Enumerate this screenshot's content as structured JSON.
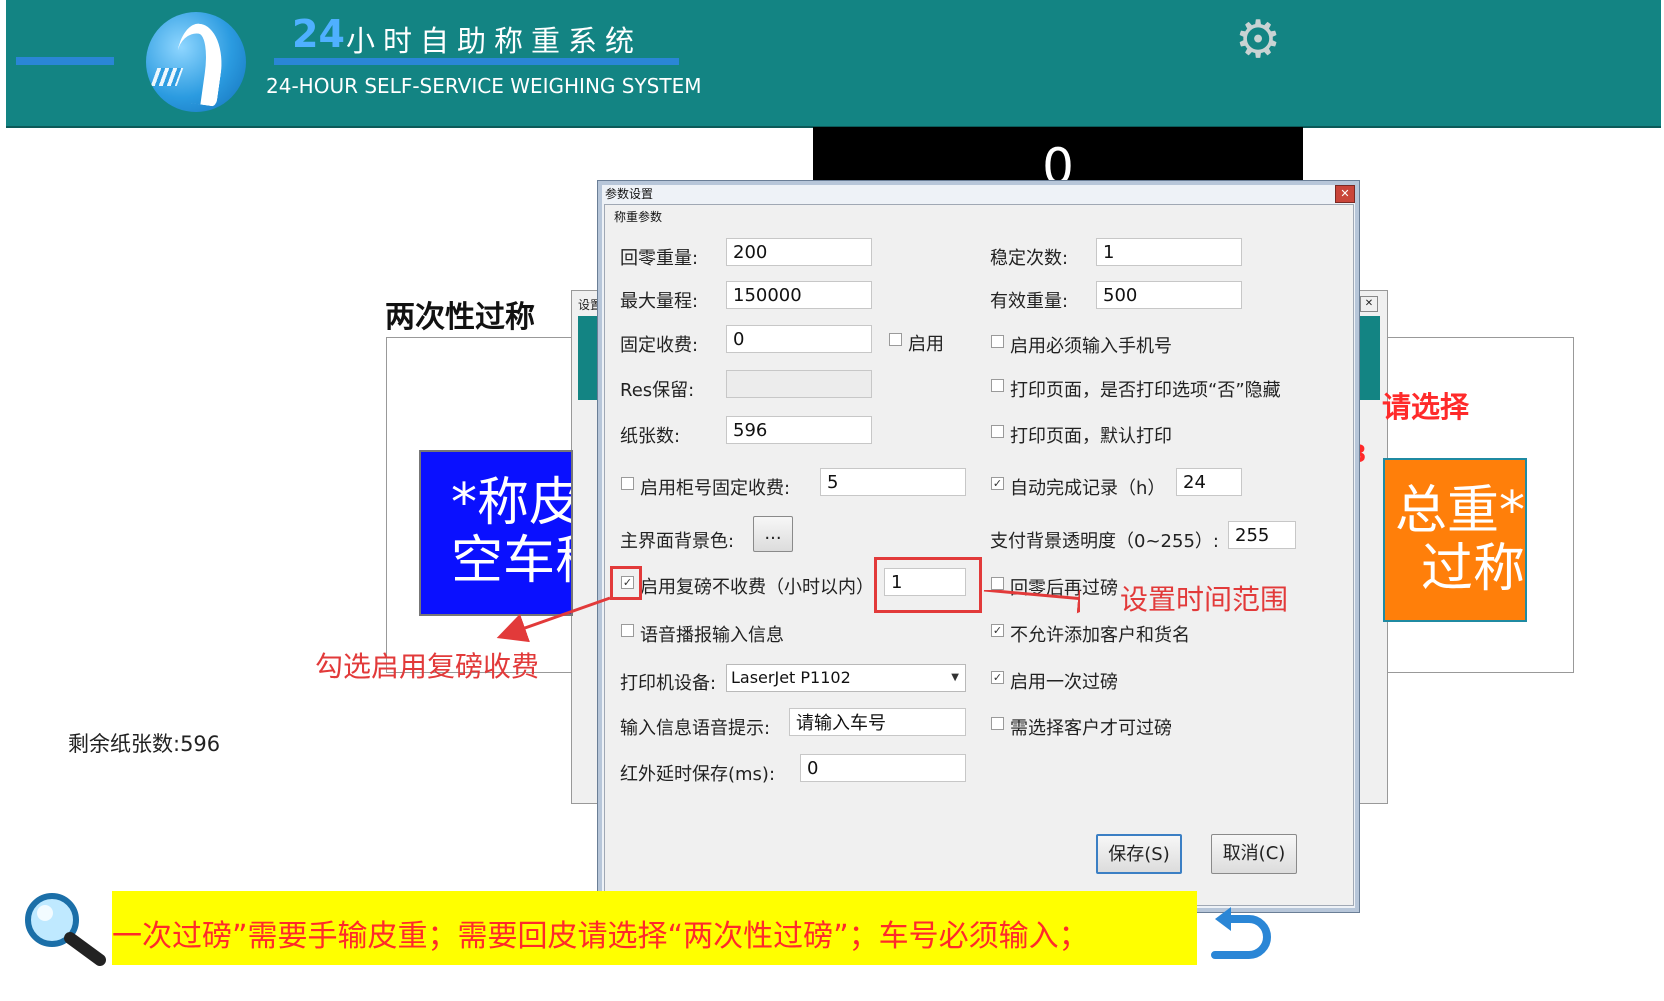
{
  "header": {
    "number": "24",
    "title": "小时自助称重系统",
    "subtitle": "24-HOUR SELF-SERVICE WEIGHING SYSTEM",
    "settings_icon": "gear-icon"
  },
  "display": {
    "weight": "0"
  },
  "background": {
    "section_title": "两次性过称",
    "behind_tab": "设置",
    "blue_button": {
      "line1": "*称皮",
      "line2": "空车称"
    },
    "orange_button": {
      "line1": "总重*",
      "line2": "过称"
    },
    "red_choose": "请选择",
    "red_mark": "3",
    "remaining_paper": "剩余纸张数:596"
  },
  "dialog": {
    "title": "参数设置",
    "group": "称重参数",
    "fields": {
      "zero_weight": {
        "label": "回零重量:",
        "value": "200"
      },
      "max_range": {
        "label": "最大量程:",
        "value": "150000"
      },
      "fixed_fee": {
        "label": "固定收费:",
        "value": "0",
        "enable_label": "启用"
      },
      "res_reserve": {
        "label": "Res保留:",
        "value": ""
      },
      "paper_count": {
        "label": "纸张数:",
        "value": "596"
      },
      "cabinet_fee": {
        "label": "启用柜号固定收费:",
        "value": "5",
        "checked": false
      },
      "bg_color": {
        "label": "主界面背景色:",
        "button": "..."
      },
      "reweigh_free": {
        "label": "启用复磅不收费（小时以内）",
        "value": "1",
        "checked": true
      },
      "voice_broadcast": {
        "label": "语音播报输入信息",
        "checked": false
      },
      "printer": {
        "label": "打印机设备:",
        "value": "LaserJet P1102"
      },
      "voice_prompt": {
        "label": "输入信息语音提示:",
        "value": "请输入车号"
      },
      "infrared_delay": {
        "label": "红外延时保存(ms):",
        "value": "0"
      },
      "stable_count": {
        "label": "稳定次数:",
        "value": "1"
      },
      "valid_weight": {
        "label": "有效重量:",
        "value": "500"
      },
      "require_phone": {
        "label": "启用必须输入手机号",
        "checked": false
      },
      "print_hide": {
        "label": "打印页面，是否打印选项“否”隐藏",
        "checked": false
      },
      "print_default": {
        "label": "打印页面，默认打印",
        "checked": false
      },
      "auto_complete": {
        "label": "自动完成记录（h）",
        "value": "24",
        "checked": true
      },
      "pay_opacity": {
        "label": "支付背景透明度（0~255）:",
        "value": "255"
      },
      "zero_then_weigh": {
        "label": "回零后再过磅",
        "checked": false
      },
      "no_add_customer": {
        "label": "不允许添加客户和货名",
        "checked": true
      },
      "single_weigh": {
        "label": "启用一次过磅",
        "checked": true
      },
      "require_customer": {
        "label": "需选择客户才可过磅",
        "checked": false
      }
    },
    "buttons": {
      "save": "保存(S)",
      "cancel": "取消(C)"
    }
  },
  "annotations": {
    "check_text": "勾选启用复磅收费",
    "range_text": "设置时间范围"
  },
  "bottom": {
    "notice": "一次过磅”需要手输皮重；需要回皮请选择“两次性过磅”；车号必须输入；",
    "magnifier_icon": "magnifier-icon",
    "back_icon": "undo-arrow-icon"
  },
  "colors": {
    "header_teal": "#138483",
    "accent_blue": "#2a86d6",
    "annotation_red": "#e23a3a",
    "notice_yellow": "#ffff00"
  }
}
